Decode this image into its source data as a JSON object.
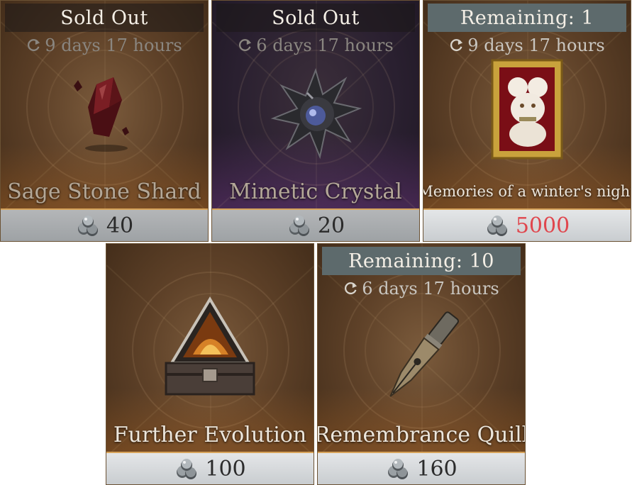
{
  "shop": {
    "items": [
      {
        "status": "Sold Out",
        "timer": "9 days 17 hours",
        "name": "Sage Stone Shard",
        "price": "40",
        "art_icon": "sage-stone-shard-icon"
      },
      {
        "status": "Sold Out",
        "timer": "6 days 17 hours",
        "name": "Mimetic Crystal",
        "price": "20",
        "art_icon": "mimetic-crystal-icon"
      },
      {
        "status": "Remaining: 1",
        "timer": "9 days 17 hours",
        "name": "Memories of a winter's night",
        "price": "5000",
        "price_color": "#e0464d",
        "art_icon": "framed-painting-icon"
      },
      {
        "status": "",
        "timer": "",
        "name": "Further Evolution",
        "price": "100",
        "art_icon": "evolution-chest-icon"
      },
      {
        "status": "Remaining: 10",
        "timer": "6 days 17 hours",
        "name": "Remembrance Quill",
        "price": "160",
        "art_icon": "quill-nib-icon"
      }
    ]
  },
  "colors": {
    "card_brown": "#5e4128",
    "card_purple": "#2a2030",
    "price_bar": "#d4d7da",
    "price_accent": "#d7a35a",
    "banner_slate": "#5d6a6c"
  }
}
